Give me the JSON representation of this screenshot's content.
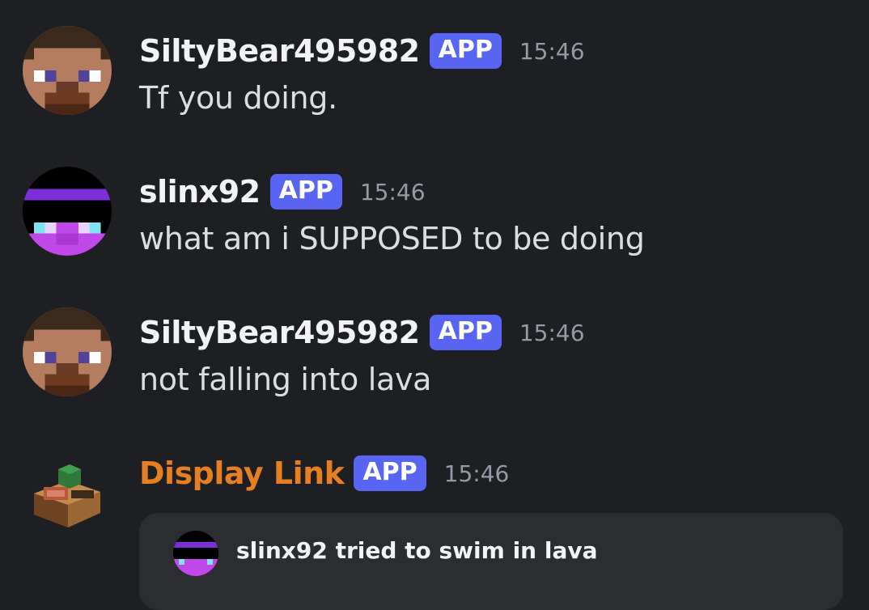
{
  "messages": [
    {
      "username": "SiltyBear495982",
      "tag": "APP",
      "time": "15:46",
      "text": "Tf you doing.",
      "name_color": "#f2f3f5",
      "avatar": "steve-skin-avatar"
    },
    {
      "username": "slinx92",
      "tag": "APP",
      "time": "15:46",
      "text": "what am i SUPPOSED to be doing",
      "name_color": "#f2f3f5",
      "avatar": "purple-skin-avatar"
    },
    {
      "username": "SiltyBear495982",
      "tag": "APP",
      "time": "15:46",
      "text": "not falling into lava",
      "name_color": "#f2f3f5",
      "avatar": "steve-skin-avatar"
    },
    {
      "username": "Display Link",
      "tag": "APP",
      "time": "15:46",
      "name_color": "#e67e22",
      "avatar": "display-link-block-avatar",
      "embed": {
        "text": "slinx92 tried to swim in lava",
        "avatar": "purple-skin-avatar"
      }
    }
  ],
  "colors": {
    "background": "#1e1f23",
    "app_tag": "#5865f2",
    "timestamp": "#949ba4",
    "embed_bg": "#2b2d31",
    "bot_name": "#e67e22"
  }
}
